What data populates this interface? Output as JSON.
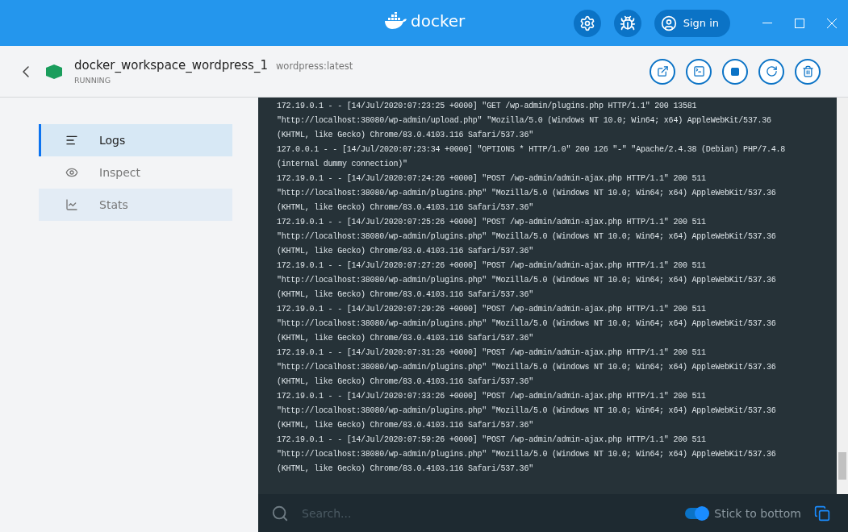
{
  "titlebar": {
    "logo_text": "docker",
    "sign_in": "Sign in"
  },
  "container": {
    "name": "docker_workspace_wordpress_1",
    "image": "wordpress:latest",
    "status": "RUNNING"
  },
  "sidebar": {
    "items": [
      {
        "label": "Logs",
        "selected": true,
        "hovered": false
      },
      {
        "label": "Inspect",
        "selected": false,
        "hovered": false
      },
      {
        "label": "Stats",
        "selected": false,
        "hovered": true
      }
    ]
  },
  "logs": {
    "lines": [
      "172.19.0.1 - - [14/Jul/2020:07:23:25 +0000] \"GET /wp-admin/plugins.php HTTP/1.1\" 200 13581",
      "\"http://localhost:38080/wp-admin/upload.php\" \"Mozilla/5.0 (Windows NT 10.0; Win64; x64) AppleWebKit/537.36",
      "(KHTML, like Gecko) Chrome/83.0.4103.116 Safari/537.36\"",
      "127.0.0.1 - - [14/Jul/2020:07:23:34 +0000] \"OPTIONS * HTTP/1.0\" 200 126 \"-\" \"Apache/2.4.38 (Debian) PHP/7.4.8",
      "(internal dummy connection)\"",
      "172.19.0.1 - - [14/Jul/2020:07:24:26 +0000] \"POST /wp-admin/admin-ajax.php HTTP/1.1\" 200 511",
      "\"http://localhost:38080/wp-admin/plugins.php\" \"Mozilla/5.0 (Windows NT 10.0; Win64; x64) AppleWebKit/537.36",
      "(KHTML, like Gecko) Chrome/83.0.4103.116 Safari/537.36\"",
      "172.19.0.1 - - [14/Jul/2020:07:25:26 +0000] \"POST /wp-admin/admin-ajax.php HTTP/1.1\" 200 511",
      "\"http://localhost:38080/wp-admin/plugins.php\" \"Mozilla/5.0 (Windows NT 10.0; Win64; x64) AppleWebKit/537.36",
      "(KHTML, like Gecko) Chrome/83.0.4103.116 Safari/537.36\"",
      "172.19.0.1 - - [14/Jul/2020:07:27:26 +0000] \"POST /wp-admin/admin-ajax.php HTTP/1.1\" 200 511",
      "\"http://localhost:38080/wp-admin/plugins.php\" \"Mozilla/5.0 (Windows NT 10.0; Win64; x64) AppleWebKit/537.36",
      "(KHTML, like Gecko) Chrome/83.0.4103.116 Safari/537.36\"",
      "172.19.0.1 - - [14/Jul/2020:07:29:26 +0000] \"POST /wp-admin/admin-ajax.php HTTP/1.1\" 200 511",
      "\"http://localhost:38080/wp-admin/plugins.php\" \"Mozilla/5.0 (Windows NT 10.0; Win64; x64) AppleWebKit/537.36",
      "(KHTML, like Gecko) Chrome/83.0.4103.116 Safari/537.36\"",
      "172.19.0.1 - - [14/Jul/2020:07:31:26 +0000] \"POST /wp-admin/admin-ajax.php HTTP/1.1\" 200 511",
      "\"http://localhost:38080/wp-admin/plugins.php\" \"Mozilla/5.0 (Windows NT 10.0; Win64; x64) AppleWebKit/537.36",
      "(KHTML, like Gecko) Chrome/83.0.4103.116 Safari/537.36\"",
      "172.19.0.1 - - [14/Jul/2020:07:33:26 +0000] \"POST /wp-admin/admin-ajax.php HTTP/1.1\" 200 511",
      "\"http://localhost:38080/wp-admin/plugins.php\" \"Mozilla/5.0 (Windows NT 10.0; Win64; x64) AppleWebKit/537.36",
      "(KHTML, like Gecko) Chrome/83.0.4103.116 Safari/537.36\"",
      "172.19.0.1 - - [14/Jul/2020:07:59:26 +0000] \"POST /wp-admin/admin-ajax.php HTTP/1.1\" 200 511",
      "\"http://localhost:38080/wp-admin/plugins.php\" \"Mozilla/5.0 (Windows NT 10.0; Win64; x64) AppleWebKit/537.36",
      "(KHTML, like Gecko) Chrome/83.0.4103.116 Safari/537.36\""
    ]
  },
  "footer": {
    "search_placeholder": "Search...",
    "stick_to_bottom": {
      "label": "Stick to bottom",
      "on": true
    }
  }
}
